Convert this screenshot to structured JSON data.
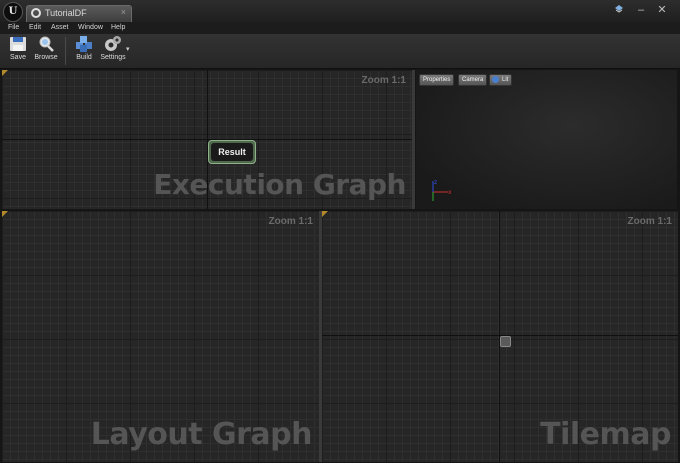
{
  "window": {
    "tab_title": "TutorialDF",
    "tab_close": "×",
    "controls": {
      "minimize": "–",
      "close": "✕"
    }
  },
  "menu": {
    "items": [
      "File",
      "Edit",
      "Asset",
      "Window",
      "Help"
    ]
  },
  "toolbar": {
    "save_label": "Save",
    "browse_label": "Browse",
    "build_label": "Build",
    "settings_label": "Settings",
    "settings_dropdown": "▾"
  },
  "execution_graph": {
    "zoom": "Zoom 1:1",
    "watermark": "Execution Graph",
    "node_label": "Result"
  },
  "viewport": {
    "buttons": [
      "Properties",
      "Camera",
      "Lit"
    ],
    "axis_x": "x",
    "axis_z": "z"
  },
  "layout_graph": {
    "zoom": "Zoom 1:1",
    "watermark": "Layout Graph"
  },
  "tilemap": {
    "zoom": "Zoom 1:1",
    "watermark": "Tilemap"
  },
  "colors": {
    "corner_accent": "#b28a2a",
    "node_border": "#8fb08a",
    "viewport_lit_icon": "#4a7fd0"
  }
}
